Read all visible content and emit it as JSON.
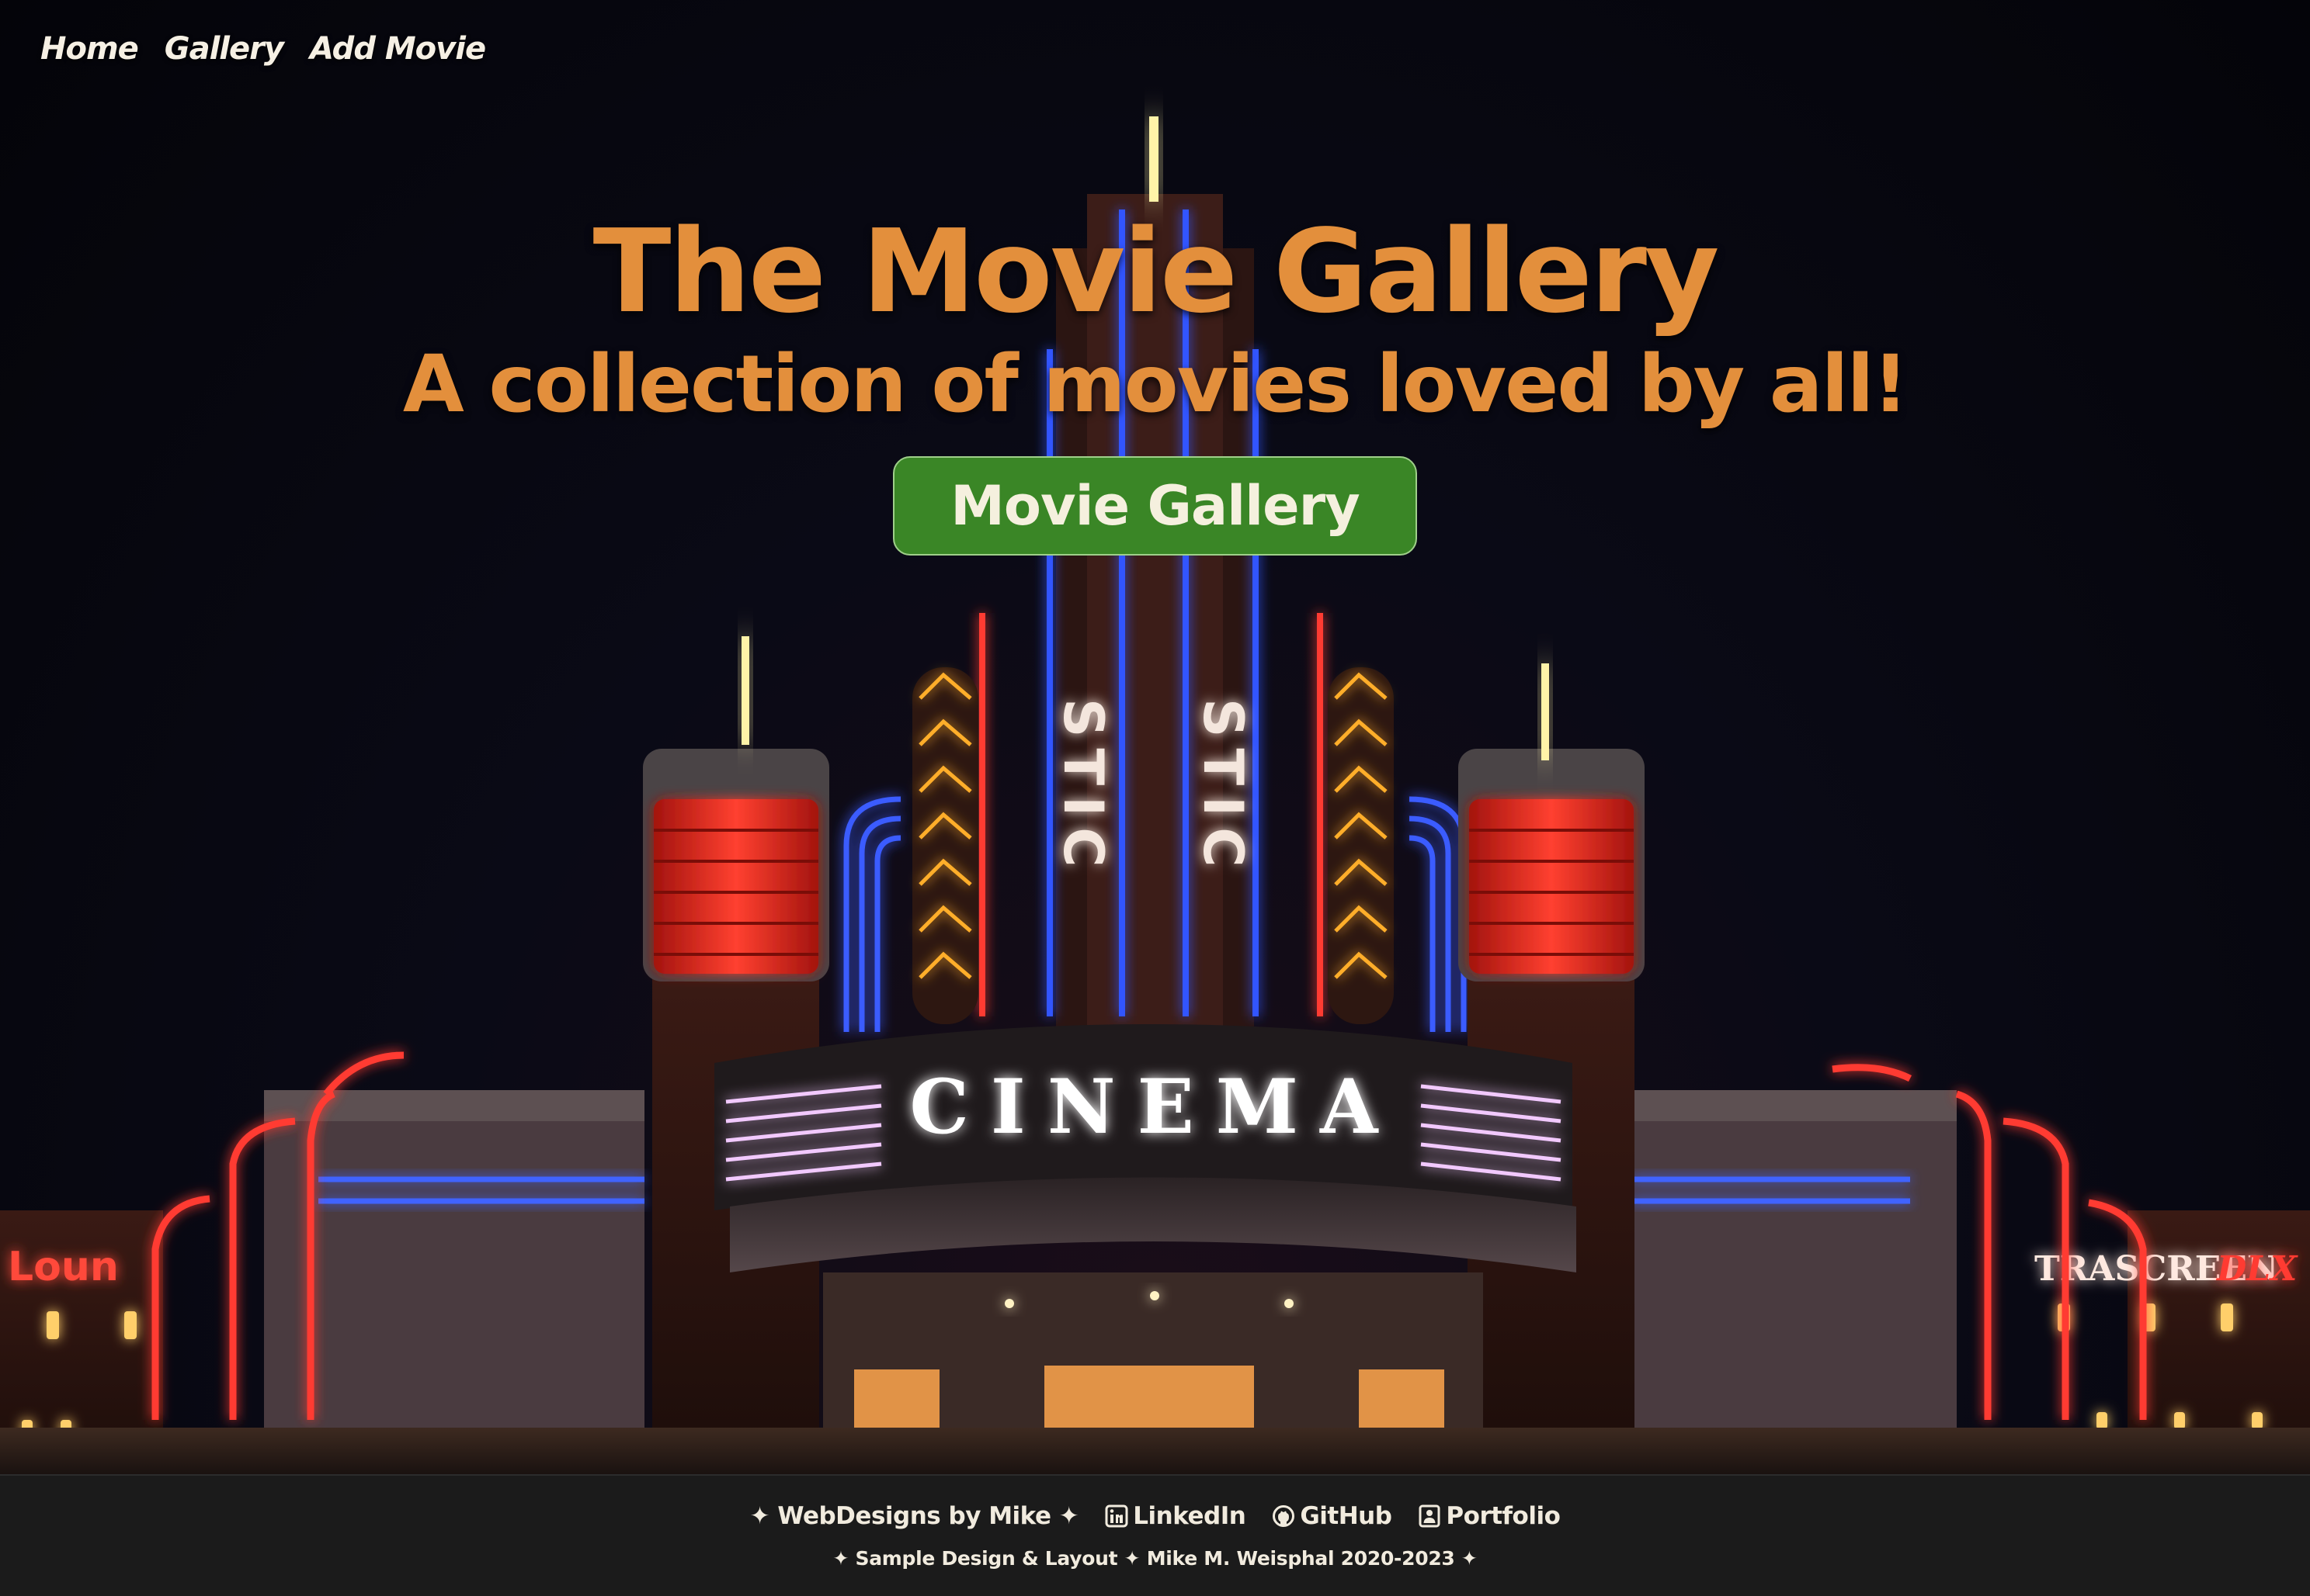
{
  "nav": {
    "items": [
      "Home",
      "Gallery",
      "Add Movie"
    ]
  },
  "hero": {
    "title": "The Movie Gallery",
    "subtitle": "A collection of movies loved by all!",
    "button_label": "Movie Gallery"
  },
  "background": {
    "marquee_text": "CINEMA",
    "tower_text": "STIC",
    "left_sign": "Loun",
    "right_sign": "TRASCREEN",
    "right_sign_suffix": "DLX"
  },
  "footer": {
    "brand": "✦ WebDesigns by Mike ✦",
    "links": [
      "LinkedIn",
      "GitHub",
      "Portfolio"
    ],
    "credit": "✦ Sample Design & Layout ✦ Mike M. Weisphal 2020-2023 ✦"
  },
  "colors": {
    "accent_orange": "#e38f3c",
    "button_green": "#3a8626",
    "footer_bg": "#1b1b1b",
    "neon_red": "#ff3b30",
    "neon_blue": "#2f58ff",
    "neon_yellow": "#ffb42a"
  },
  "icons": {
    "linkedin": "linkedin-icon",
    "github": "github-icon",
    "portfolio": "portfolio-icon"
  }
}
